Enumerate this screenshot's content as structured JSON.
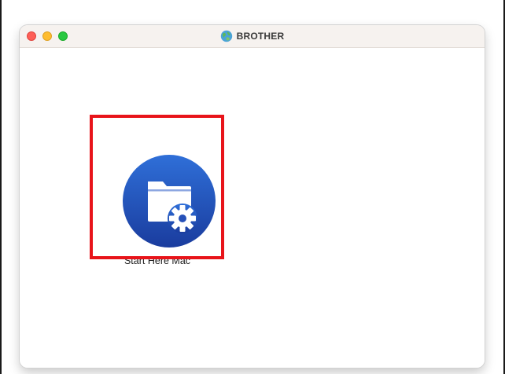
{
  "window": {
    "title": "BROTHER",
    "title_icon": "brother-globe-icon",
    "controls": [
      "close",
      "minimize",
      "maximize"
    ]
  },
  "items": [
    {
      "label": "Start Here Mac",
      "icon": "folder-gear-icon",
      "selected": true
    }
  ],
  "colors": {
    "highlight": "#e8141a",
    "icon_circle_top": "#2f6fd8",
    "icon_circle_bottom": "#1a3c9e",
    "titlebar": "#f6f2ef",
    "close": "#fe5f57",
    "minimize": "#febc2e",
    "maximize": "#28c840"
  }
}
